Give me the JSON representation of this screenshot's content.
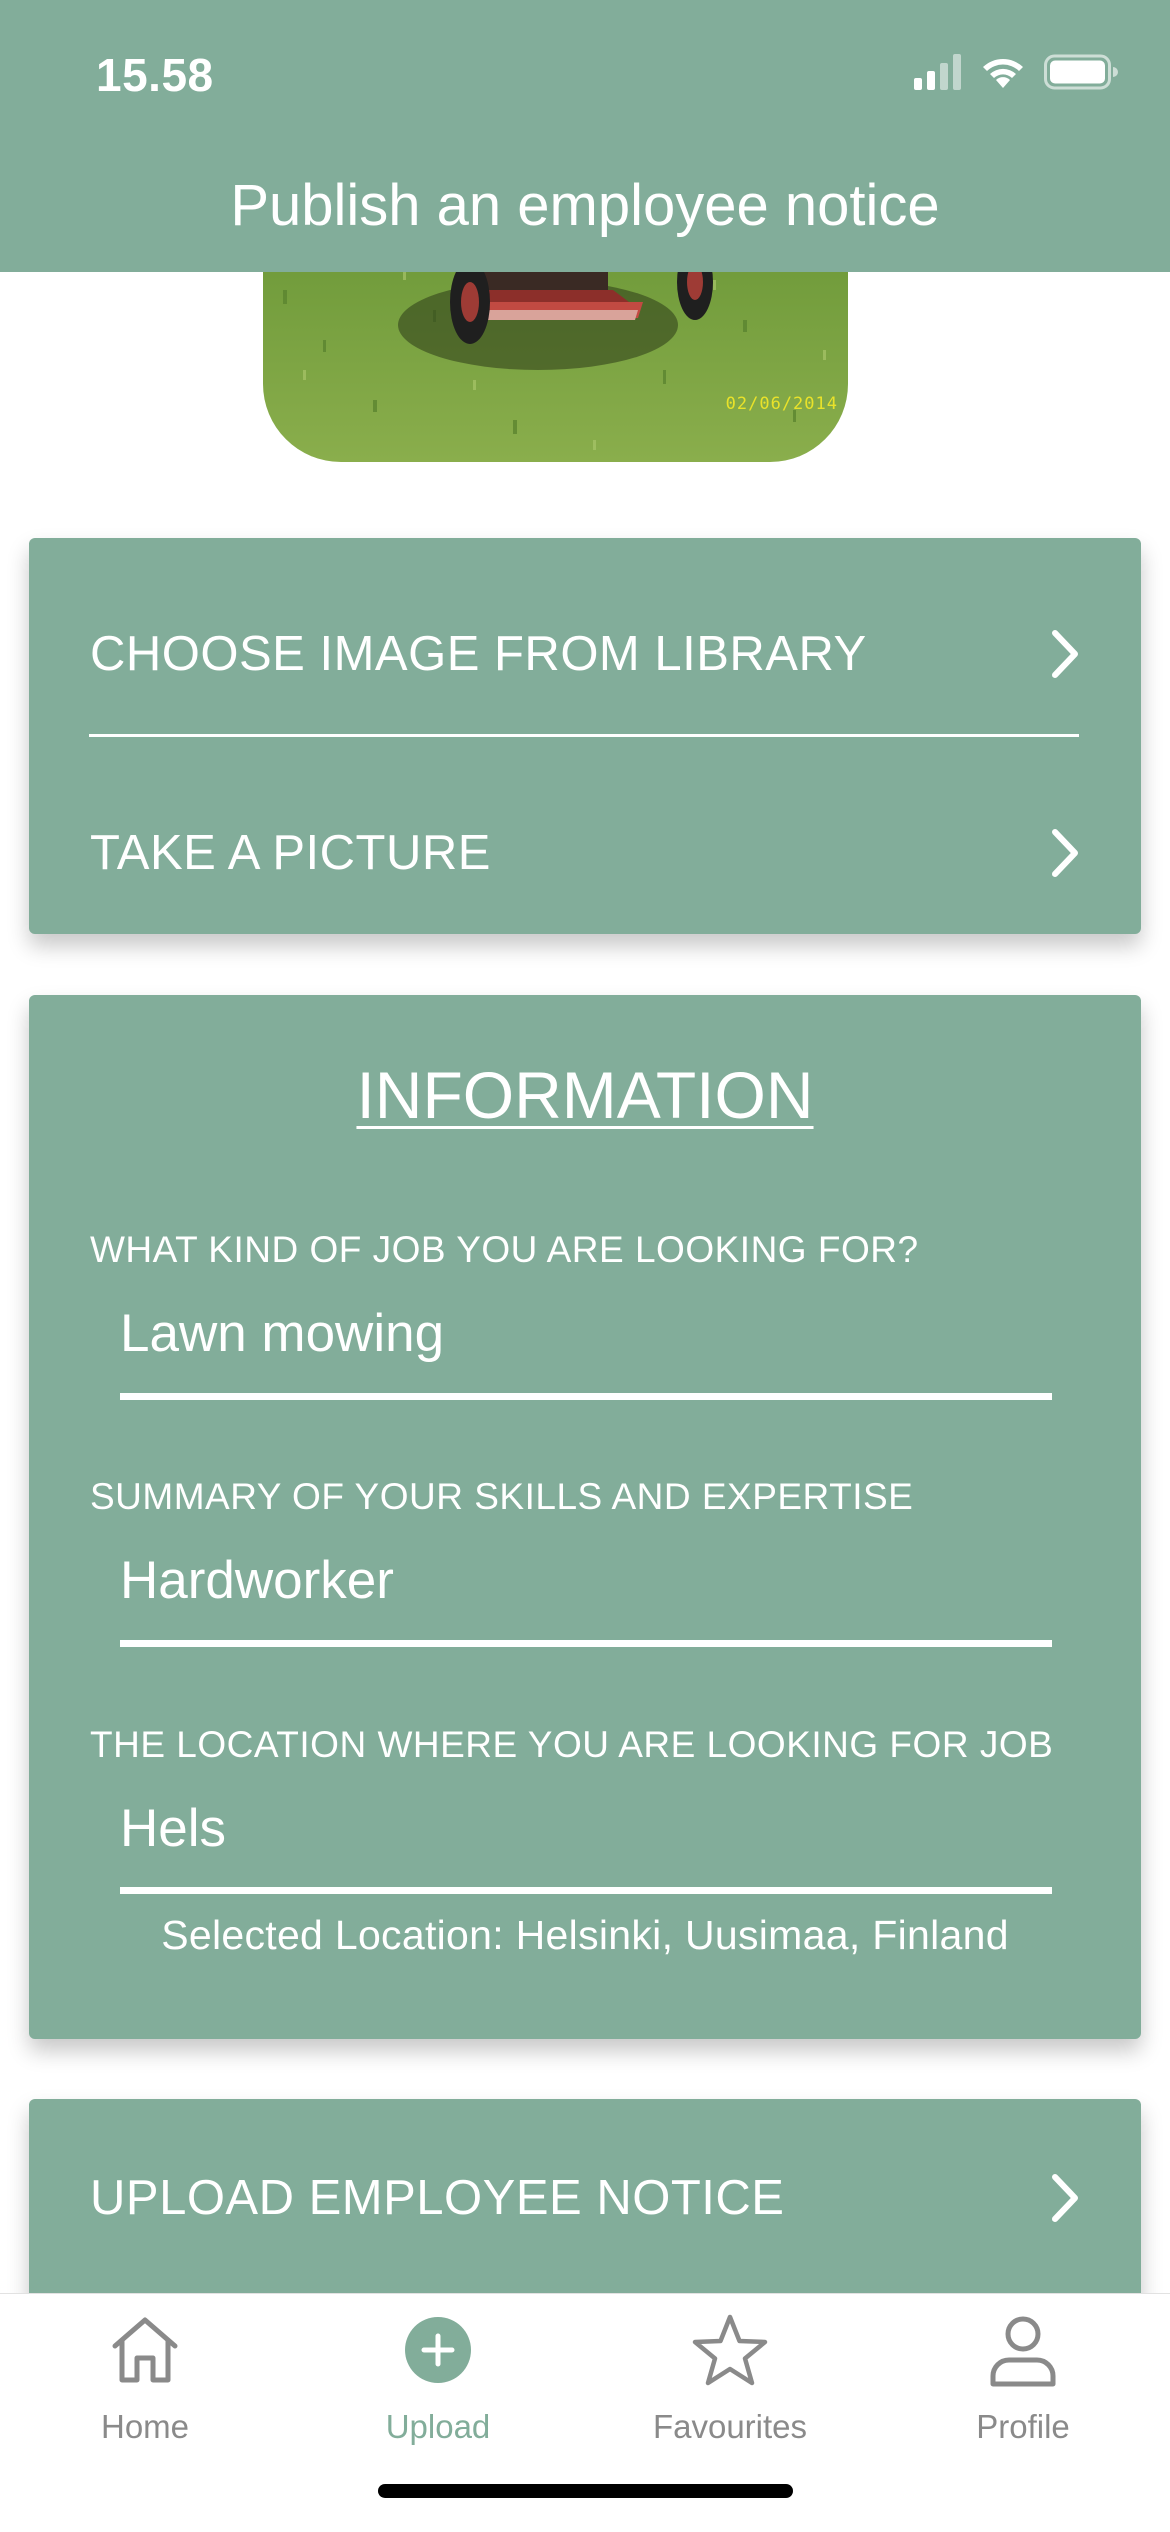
{
  "status_bar": {
    "time": "15.58"
  },
  "header": {
    "title": "Publish an employee notice"
  },
  "photo": {
    "date_stamp": "02/06/2014"
  },
  "image_actions": {
    "choose_library_label": "CHOOSE IMAGE FROM LIBRARY",
    "take_picture_label": "TAKE A PICTURE"
  },
  "information": {
    "title": "INFORMATION",
    "job_label": "WHAT KIND OF JOB YOU ARE LOOKING FOR?",
    "job_value": "Lawn mowing",
    "skills_label": "SUMMARY OF YOUR SKILLS AND EXPERTISE",
    "skills_value": "Hardworker",
    "location_label": "THE LOCATION WHERE YOU ARE LOOKING FOR JOB",
    "location_value": "Hels",
    "selected_location": "Selected Location: Helsinki, Uusimaa, Finland"
  },
  "upload": {
    "label": "UPLOAD EMPLOYEE NOTICE"
  },
  "tabbar": {
    "home": "Home",
    "upload": "Upload",
    "favourites": "Favourites",
    "profile": "Profile",
    "active": "upload"
  },
  "colors": {
    "accent": "#82ad9a",
    "tab_inactive": "#8a8a8a"
  }
}
